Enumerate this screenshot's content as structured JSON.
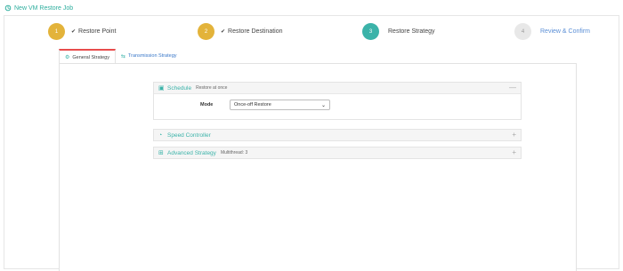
{
  "window": {
    "title": "New VM Restore Job",
    "icon": "restore-job-icon"
  },
  "stepper": [
    {
      "number": "1",
      "label": "Restore Point",
      "state": "done",
      "check": "✔"
    },
    {
      "number": "2",
      "label": "Restore Destination",
      "state": "done",
      "check": "✔"
    },
    {
      "number": "3",
      "label": "Restore Strategy",
      "state": "active",
      "check": ""
    },
    {
      "number": "4",
      "label": "Review & Confirm",
      "state": "pending",
      "check": ""
    }
  ],
  "tabs": [
    {
      "label": "General Strategy",
      "icon": "strategy-icon",
      "active": true
    },
    {
      "label": "Transmission Strategy",
      "icon": "transmission-icon",
      "active": false
    }
  ],
  "panels": {
    "schedule": {
      "title": "Schedule",
      "description": "Restore at once",
      "toggle": "—",
      "mode_label": "Mode",
      "mode_value": "Once-off Restore"
    },
    "speed": {
      "title": "Speed Controller",
      "description": "",
      "toggle": "+"
    },
    "advanced": {
      "title": "Advanced Strategy",
      "description": "Multithread: 3",
      "toggle": "+"
    }
  },
  "colors": {
    "accent": "#3bb3a9",
    "done": "#e3b33a",
    "pending": "#e8e8e8",
    "link": "#3a78c9",
    "active_tab": "#e84c4c"
  }
}
